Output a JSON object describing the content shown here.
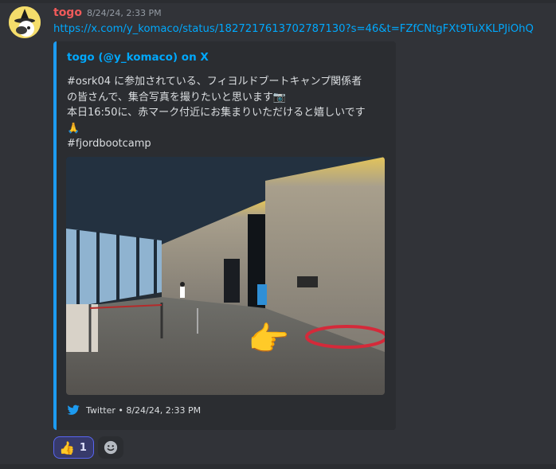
{
  "message": {
    "author": "togo",
    "timestamp": "8/24/24, 2:33 PM",
    "link": "https://x.com/y_komaco/status/1827217613702787130?s=46&t=FZfCNtgFXt9TuXKLPJiOhQ"
  },
  "embed": {
    "title": "togo (@y_komaco) on X",
    "lines": [
      "#osrk04 に参加されている、フィヨルドブートキャンプ関係者",
      "の皆さんで、集合写真を撮りたいと思います📷",
      "本日16:50に、赤マーク付近にお集まりいただけると嬉しいです",
      "🙏",
      "#fjordbootcamp"
    ],
    "footer": "Twitter • 8/24/24, 2:33 PM",
    "image_emoji": "👉"
  },
  "reactions": {
    "thumbs_emoji": "👍",
    "thumbs_count": "1",
    "add_reaction_icon": "smile-icon"
  },
  "colors": {
    "background": "#313338",
    "embed_bg": "#2b2d31",
    "embed_accent": "#1d9bf0",
    "author": "#f05a5a",
    "link": "#00a8fc",
    "reaction_bg": "#373a6b",
    "reaction_border": "#5865f2"
  }
}
